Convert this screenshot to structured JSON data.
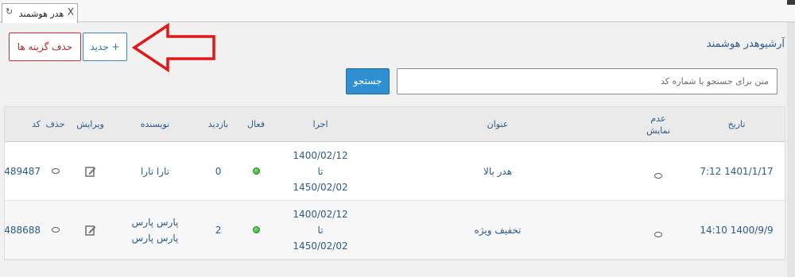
{
  "tab": {
    "title": "هدر هوشمند",
    "close": "X",
    "refresh": "↻"
  },
  "toolbar": {
    "delete_label": "حذف گزینه ها",
    "new_label": "+ جدید"
  },
  "page_title": "آرشیوهدر هوشمند",
  "search": {
    "placeholder": "متن برای جستجو یا شماره کد",
    "button": "جستجو"
  },
  "columns": {
    "date": "تاریخ",
    "hide": "عدم نمایش",
    "title": "عنوان",
    "run": "اجرا",
    "active": "فعال",
    "visits": "بازدید",
    "author": "نویسنده",
    "edit": "ویرایش",
    "delete": "حذف",
    "code": "کد"
  },
  "rows": [
    {
      "date": "1401/1/17 7:12",
      "title": "هدر بالا",
      "run_from": "1400/02/12",
      "run_to_word": "تا",
      "run_to": "1450/02/02",
      "visits": "0",
      "author": "تارا تارا",
      "code": "489487"
    },
    {
      "date": "1400/9/9 14:10",
      "title": "تخفیف ویژه",
      "run_from": "1400/02/12",
      "run_to_word": "تا",
      "run_to": "1450/02/02",
      "visits": "2",
      "author_line1": "پارس پارس",
      "author_line2": "پارس پارس",
      "code": "488688"
    }
  ],
  "colors": {
    "accent": "#2f8fd0",
    "delete": "#c9302c",
    "annotation_arrow": "#e01818",
    "active_dot": "#2aa52a",
    "link_text": "#2c5b88"
  },
  "icons": {
    "tab_refresh": "refresh-icon",
    "tab_close": "close-icon",
    "edit": "pencil-icon",
    "active": "green-dot-icon",
    "annotation": "arrow-left-icon"
  }
}
